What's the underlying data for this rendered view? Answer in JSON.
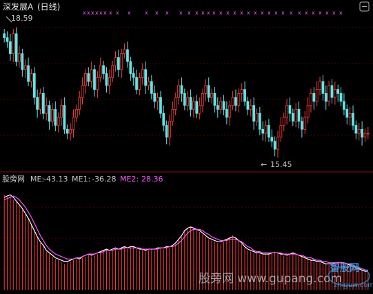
{
  "header": {
    "title": "深发展A",
    "period": "(日线)",
    "price_high_label": "18.59",
    "price_low_label": "15.45",
    "low_arrow": "←"
  },
  "indicator": {
    "name": "股旁网",
    "me_label": "ME:",
    "me_value": "-43.13",
    "me1_label": "ME1:",
    "me1_value": "-36.28",
    "me2_label": "ME2:",
    "me2_value": "28.36"
  },
  "watermark": {
    "text": "股旁网  www.gupang.com",
    "logo_text": "智股网",
    "logo_url": "zhiguw.com"
  },
  "colors": {
    "background": "#000000",
    "up": "#ff3b3b",
    "down": "#5fe6e6",
    "grid": "#8a1010",
    "me1_line": "#ffffff",
    "me2_line": "#ff55ff",
    "marker": "#ff55ff",
    "label": "#c8c8c8",
    "me2_label": "#ff55ff"
  },
  "chart_data": [
    {
      "type": "candlestick",
      "title": "深发展A (日线)",
      "ylim": [
        15.0,
        18.9
      ],
      "annotations": [
        {
          "label": "18.59",
          "value": 18.59,
          "bar": 2
        },
        {
          "label": "15.45",
          "value": 15.45,
          "bar": 91
        }
      ],
      "series_close": [
        18.3,
        18.2,
        17.9,
        18.4,
        17.7,
        17.9,
        17.5,
        17.6,
        17.2,
        17.4,
        16.8,
        16.5,
        16.9,
        16.4,
        16.6,
        16.2,
        16.5,
        16.1,
        16.3,
        16.6,
        16.0,
        15.9,
        16.0,
        16.3,
        16.5,
        16.8,
        17.1,
        17.4,
        17.2,
        17.5,
        17.0,
        17.3,
        17.6,
        17.4,
        17.1,
        17.3,
        17.6,
        17.8,
        17.5,
        17.9,
        18.0,
        17.7,
        17.4,
        17.3,
        17.0,
        17.3,
        17.5,
        17.1,
        17.2,
        16.9,
        16.7,
        16.8,
        16.4,
        16.1,
        15.8,
        16.2,
        16.5,
        16.8,
        17.1,
        16.9,
        16.6,
        16.8,
        16.5,
        16.7,
        16.4,
        16.6,
        16.9,
        17.1,
        16.8,
        16.9,
        16.6,
        16.5,
        16.7,
        16.5,
        16.3,
        16.6,
        16.8,
        16.6,
        16.9,
        17.0,
        16.7,
        16.5,
        16.6,
        16.2,
        16.4,
        16.0,
        15.9,
        16.1,
        15.8,
        15.7,
        15.5,
        15.8,
        16.1,
        16.3,
        16.6,
        16.4,
        16.2,
        16.5,
        16.2,
        16.0,
        16.3,
        16.6,
        16.9,
        16.7,
        17.0,
        17.2,
        16.9,
        16.7,
        17.1,
        16.8,
        17.0,
        16.9,
        16.7,
        16.5,
        16.3,
        16.4,
        16.1,
        15.9,
        16.0,
        15.8,
        15.9,
        15.9
      ]
    },
    {
      "type": "bar+line",
      "series": [
        {
          "name": "ME",
          "values": [
            -18,
            -20,
            -19,
            -22,
            -24,
            -27,
            -30,
            -34,
            -38,
            -42,
            -48,
            -52,
            -57,
            -60,
            -64,
            -66,
            -68,
            -70,
            -71,
            -72,
            -74,
            -73,
            -72,
            -71,
            -70,
            -71,
            -69,
            -68,
            -66,
            -68,
            -67,
            -66,
            -64,
            -63,
            -62,
            -64,
            -63,
            -62,
            -63,
            -61,
            -60,
            -62,
            -61,
            -60,
            -62,
            -63,
            -62,
            -64,
            -63,
            -62,
            -63,
            -62,
            -61,
            -62,
            -60,
            -61,
            -60,
            -58,
            -55,
            -52,
            -48,
            -45,
            -44,
            -45,
            -46,
            -48,
            -50,
            -52,
            -54,
            -55,
            -56,
            -57,
            -58,
            -56,
            -54,
            -52,
            -51,
            -53,
            -55,
            -58,
            -61,
            -63,
            -64,
            -65,
            -65,
            -66,
            -67,
            -67,
            -66,
            -65,
            -64,
            -65,
            -66,
            -67,
            -68,
            -66,
            -65,
            -66,
            -67,
            -68,
            -69,
            -70,
            -71,
            -72,
            -73,
            -73,
            -74,
            -74,
            -75,
            -74,
            -73,
            -72,
            -72,
            -73,
            -74,
            -75,
            -76,
            -77,
            -78,
            -79,
            -80,
            -81
          ]
        },
        {
          "name": "ME1",
          "values": [
            -20,
            -19,
            -18,
            -20,
            -23,
            -26,
            -29,
            -33,
            -37,
            -42,
            -47,
            -52,
            -56,
            -59,
            -63,
            -65,
            -67,
            -69,
            -70,
            -71,
            -72,
            -72,
            -71,
            -70,
            -69,
            -70,
            -68,
            -67,
            -66,
            -67,
            -66,
            -65,
            -64,
            -63,
            -62,
            -63,
            -62,
            -61,
            -62,
            -61,
            -60,
            -61,
            -60,
            -60,
            -61,
            -62,
            -62,
            -63,
            -62,
            -62,
            -62,
            -61,
            -61,
            -61,
            -60,
            -60,
            -59,
            -57,
            -54,
            -51,
            -47,
            -45,
            -44,
            -45,
            -46,
            -47,
            -49,
            -51,
            -53,
            -54,
            -55,
            -56,
            -56,
            -55,
            -54,
            -53,
            -52,
            -53,
            -55,
            -57,
            -60,
            -62,
            -63,
            -64,
            -65,
            -65,
            -66,
            -66,
            -66,
            -65,
            -65,
            -65,
            -66,
            -66,
            -67,
            -66,
            -65,
            -66,
            -67,
            -68,
            -69,
            -70,
            -71,
            -71,
            -72,
            -72,
            -73,
            -74,
            -74,
            -74,
            -73,
            -73,
            -73,
            -73,
            -74,
            -75,
            -76,
            -77,
            -78,
            -79,
            -80,
            -80
          ]
        },
        {
          "name": "ME2",
          "values": [
            -22,
            -21,
            -20,
            -19,
            -20,
            -22,
            -25,
            -28,
            -32,
            -36,
            -41,
            -46,
            -51,
            -55,
            -59,
            -62,
            -64,
            -66,
            -67,
            -68,
            -69,
            -70,
            -70,
            -70,
            -69,
            -69,
            -68,
            -67,
            -66,
            -66,
            -66,
            -65,
            -65,
            -64,
            -63,
            -63,
            -63,
            -62,
            -62,
            -62,
            -61,
            -61,
            -61,
            -61,
            -61,
            -61,
            -62,
            -62,
            -62,
            -62,
            -62,
            -62,
            -61,
            -61,
            -61,
            -60,
            -60,
            -59,
            -57,
            -55,
            -52,
            -49,
            -47,
            -46,
            -46,
            -46,
            -47,
            -49,
            -50,
            -52,
            -53,
            -54,
            -55,
            -55,
            -55,
            -54,
            -54,
            -54,
            -55,
            -56,
            -58,
            -60,
            -61,
            -63,
            -64,
            -64,
            -65,
            -65,
            -65,
            -65,
            -65,
            -65,
            -65,
            -66,
            -66,
            -66,
            -66,
            -66,
            -67,
            -67,
            -68,
            -69,
            -69,
            -70,
            -71,
            -71,
            -72,
            -72,
            -73,
            -73,
            -73,
            -73,
            -73,
            -73,
            -74,
            -74,
            -75,
            -76,
            -77,
            -78,
            -79,
            -79
          ]
        }
      ]
    }
  ]
}
